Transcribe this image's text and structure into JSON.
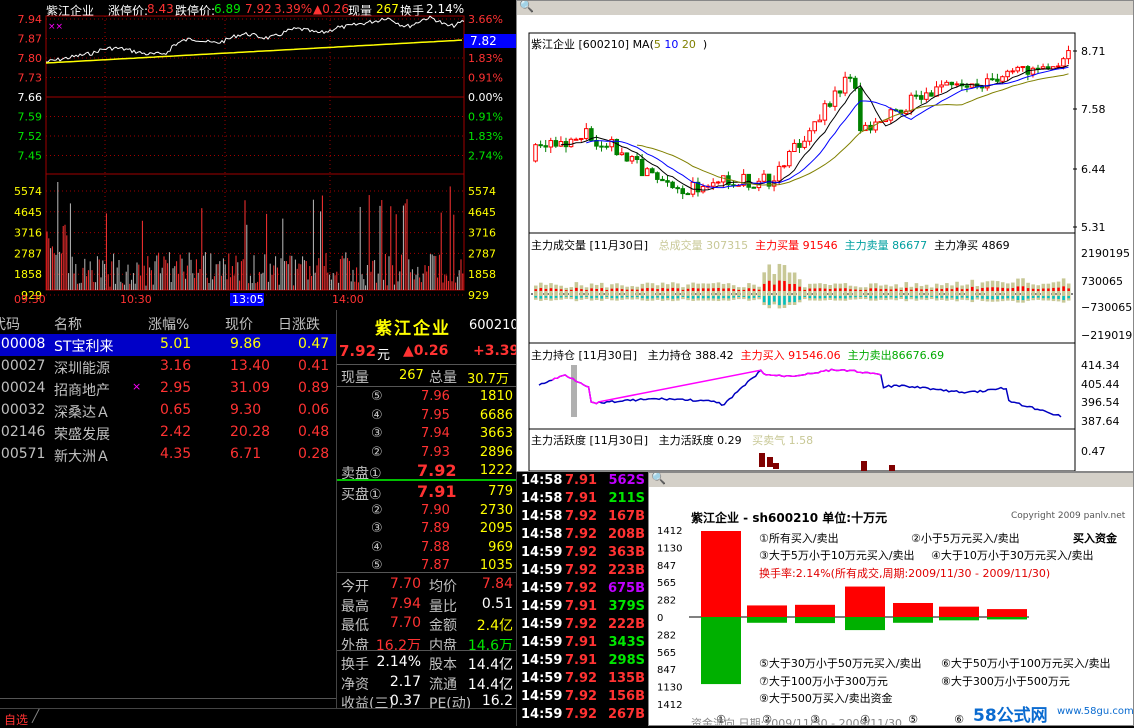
{
  "intraday": {
    "stock_name": "紫江企业",
    "limit_up_label": "涨停价:",
    "limit_up": "8.43",
    "limit_down_label": "跌停价:",
    "limit_down": "6.89",
    "price": "7.92",
    "pct": "3.39%",
    "change": "▲0.26",
    "vol_label": "现量",
    "vol": "267",
    "turnover_label": "换手",
    "turnover": "2.14%",
    "price_ticks_left": [
      "7.94",
      "7.87",
      "7.80",
      "7.73",
      "7.66",
      "7.59",
      "7.52",
      "7.45"
    ],
    "pct_ticks_right": [
      "3.66%",
      "2.74%",
      "1.83%",
      "0.91%",
      "0.00%",
      "0.91%",
      "1.83%",
      "2.74%"
    ],
    "vol_ticks_left": [
      "5574",
      "4645",
      "3716",
      "2787",
      "1858",
      "929"
    ],
    "vol_ticks_right": [
      "5574",
      "4645",
      "3716",
      "2787",
      "1858",
      "929"
    ],
    "time_ticks": [
      "09:30",
      "10:30",
      "13:05",
      "14:00"
    ],
    "current_price_tag": "7.82",
    "xx_marker": "××"
  },
  "quote_list": {
    "headers": [
      "代码",
      "名称",
      "涨幅%",
      "现价",
      "日涨跌"
    ],
    "rows": [
      {
        "code": "000008",
        "name": "ST宝利来",
        "pct": "5.01",
        "price": "9.86",
        "chg": "0.47",
        "mark": ""
      },
      {
        "code": "000027",
        "name": "深圳能源",
        "pct": "3.16",
        "price": "13.40",
        "chg": "0.41",
        "mark": ""
      },
      {
        "code": "000024",
        "name": "招商地产",
        "pct": "2.95",
        "price": "31.09",
        "chg": "0.89",
        "mark": "×"
      },
      {
        "code": "000032",
        "name": "深桑达Ａ",
        "pct": "0.65",
        "price": "9.30",
        "chg": "0.06",
        "mark": ""
      },
      {
        "code": "002146",
        "name": "荣盛发展",
        "pct": "2.42",
        "price": "20.28",
        "chg": "0.48",
        "mark": ""
      },
      {
        "code": "000571",
        "name": "新大洲Ａ",
        "pct": "4.35",
        "price": "6.71",
        "chg": "0.28",
        "mark": ""
      }
    ],
    "bottom_tab": "自选"
  },
  "quote_panel": {
    "name": "紫江企业",
    "code": "600210",
    "price": "7.92",
    "unit": "元",
    "change": "▲0.26",
    "pct": "+3.39",
    "cur_vol_label": "现量",
    "cur_vol": "267",
    "total_vol_label": "总量",
    "total_vol": "30.7万",
    "sells": [
      {
        "lv": "⑤",
        "p": "7.96",
        "v": "1810"
      },
      {
        "lv": "④",
        "p": "7.95",
        "v": "6686"
      },
      {
        "lv": "③",
        "p": "7.94",
        "v": "3663"
      },
      {
        "lv": "②",
        "p": "7.93",
        "v": "2896"
      },
      {
        "lv": "卖盘①",
        "p": "7.92",
        "v": "1222"
      }
    ],
    "buys": [
      {
        "lv": "买盘①",
        "p": "7.91",
        "v": "779"
      },
      {
        "lv": "②",
        "p": "7.90",
        "v": "2730"
      },
      {
        "lv": "③",
        "p": "7.89",
        "v": "2095"
      },
      {
        "lv": "④",
        "p": "7.88",
        "v": "969"
      },
      {
        "lv": "⑤",
        "p": "7.87",
        "v": "1035"
      }
    ],
    "stats": [
      {
        "l1": "今开",
        "v1": "7.70",
        "l2": "均价",
        "v2": "7.84"
      },
      {
        "l1": "最高",
        "v1": "7.94",
        "l2": "量比",
        "v2": "0.51"
      },
      {
        "l1": "最低",
        "v1": "7.70",
        "l2": "金额",
        "v2": "2.4亿"
      },
      {
        "l1": "外盘",
        "v1": "16.2万",
        "l2": "内盘",
        "v2": "14.6万"
      }
    ],
    "stats2": [
      {
        "l1": "换手",
        "v1": "2.14%",
        "l2": "股本",
        "v2": "14.4亿"
      },
      {
        "l1": "净资",
        "v1": "2.17",
        "l2": "流通",
        "v2": "14.4亿"
      },
      {
        "l1": "收益(三)",
        "v1": "0.37",
        "l2": "PE(动)",
        "v2": "16.2"
      }
    ]
  },
  "ticks": [
    {
      "t": "14:58",
      "p": "7.91",
      "v": "562",
      "f": "S"
    },
    {
      "t": "14:58",
      "p": "7.91",
      "v": "211",
      "f": "S"
    },
    {
      "t": "14:58",
      "p": "7.92",
      "v": "167",
      "f": "B"
    },
    {
      "t": "14:58",
      "p": "7.92",
      "v": "208",
      "f": "B"
    },
    {
      "t": "14:59",
      "p": "7.92",
      "v": "363",
      "f": "B"
    },
    {
      "t": "14:59",
      "p": "7.92",
      "v": "223",
      "f": "B"
    },
    {
      "t": "14:59",
      "p": "7.92",
      "v": "675",
      "f": "B"
    },
    {
      "t": "14:59",
      "p": "7.91",
      "v": "379",
      "f": "S"
    },
    {
      "t": "14:59",
      "p": "7.92",
      "v": "222",
      "f": "B"
    },
    {
      "t": "14:59",
      "p": "7.91",
      "v": "343",
      "f": "S"
    },
    {
      "t": "14:59",
      "p": "7.91",
      "v": "298",
      "f": "S"
    },
    {
      "t": "14:59",
      "p": "7.92",
      "v": "135",
      "f": "B"
    },
    {
      "t": "14:59",
      "p": "7.92",
      "v": "156",
      "f": "B"
    },
    {
      "t": "14:59",
      "p": "7.92",
      "v": "267",
      "f": "B"
    }
  ],
  "kchart": {
    "header": "紫江企业  [600210]  MA(",
    "ma": [
      "5",
      "10",
      "20"
    ],
    "header_end": ")",
    "price_ticks": [
      "8.71",
      "7.58",
      "6.44",
      "5.31"
    ],
    "vol_header": "主力成交量  [11月30日]",
    "vol_total_label": "总成交量",
    "vol_total": "307315",
    "vol_buy_label": "主力买量",
    "vol_buy": "91546",
    "vol_sell_label": "主力卖量",
    "vol_sell": "86677",
    "vol_net_label": "主力净买",
    "vol_net": "4869",
    "vol_ticks": [
      "2190195",
      "730065",
      "−730065",
      "−2190195"
    ],
    "hold_header": "主力持仓  [11月30日]",
    "hold_label": "主力持仓",
    "hold": "388.42",
    "hold_buy_label": "主力买入",
    "hold_buy": "91546.06",
    "hold_sell_label": "主力卖出",
    "hold_sell": "86676.69",
    "hold_ticks": [
      "414.34",
      "405.44",
      "396.54",
      "387.64"
    ],
    "act_header": "主力活跃度  [11月30日]",
    "act_label": "主力活跃度",
    "act": "0.29",
    "act2_label": "买卖气",
    "act2": "1.58",
    "act_ticks": [
      "0.47"
    ]
  },
  "fund": {
    "title": "紫江企业 - sh600210   单位:十万元",
    "copyright": "Copyright 2009 panlv.net",
    "y_ticks": [
      "1412",
      "1130",
      "847",
      "565",
      "282",
      "0",
      "282",
      "565",
      "847",
      "1130",
      "1412"
    ],
    "legend": [
      "①所有买入/卖出",
      "②小于5万元买入/卖出",
      "③大于5万小于10万元买入/卖出",
      "④大于10万小于30万元买入/卖出",
      "⑤大于30万小于50万元买入/卖出",
      "⑥大于50万小于100万元买入/卖出",
      "⑦大于100万小于300万元",
      "⑧大于300万小于500万元",
      "⑨大于500万买入/卖出资金"
    ],
    "buy_label": "买入资金",
    "turnover_note": "换手率:2.14%(所有成交,周期:2009/11/30 - 2009/11/30)",
    "x_ticks": [
      "①",
      "②",
      "③",
      "④",
      "⑤",
      "⑥"
    ],
    "buy": [
      1412,
      190,
      200,
      500,
      230,
      170,
      130,
      0,
      0
    ],
    "sell": [
      1412,
      190,
      200,
      430,
      190,
      110,
      80,
      0,
      0
    ],
    "bottom_text": "资金流向    日期:2009/11/30 - 2009/11/30",
    "watermark": "58公式网",
    "watermark_url": "www.58gu.com"
  },
  "colors": {
    "up": "#ff3232",
    "down": "#00e600",
    "ma5": "#000000",
    "ma10": "#0000ff",
    "ma20": "#808000"
  }
}
